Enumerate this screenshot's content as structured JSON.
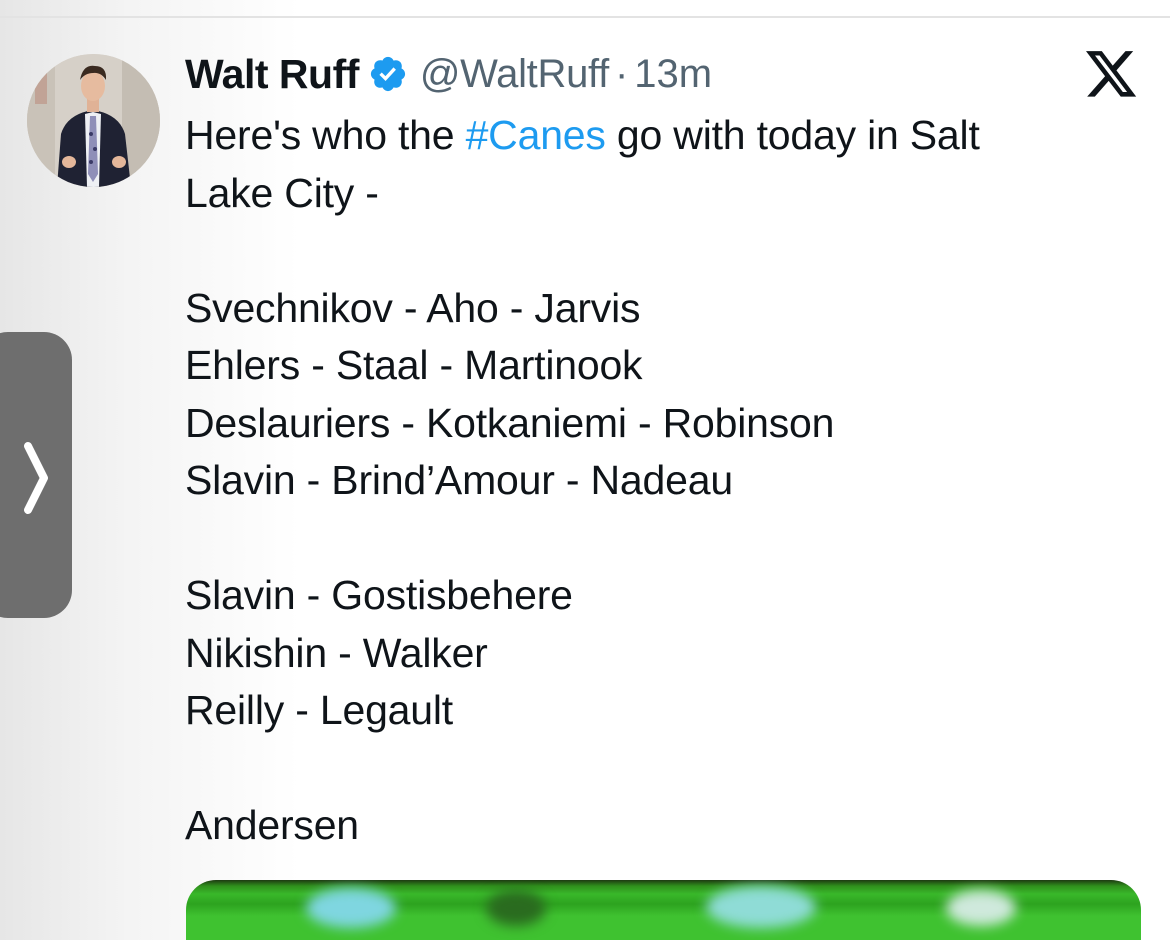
{
  "tweet": {
    "author_name": "Walt Ruff",
    "handle": "@WaltRuff",
    "separator": "·",
    "timestamp": "13m",
    "verified": true,
    "text_lines": [
      [
        "Here's who the ",
        "#Canes",
        " go with today in Salt"
      ],
      "Lake City -",
      "",
      "Svechnikov - Aho - Jarvis",
      "Ehlers - Staal - Martinook",
      "Deslauriers - Kotkaniemi - Robinson",
      "Slavin - Brind’Amour - Nadeau",
      "",
      "Slavin - Gostisbehere",
      "Nikishin - Walker",
      "Reilly - Legault",
      "",
      "Andersen"
    ]
  },
  "icons": {
    "verified": "verified-badge-icon",
    "brand": "x-logo-icon",
    "side_panel": "chevron-right-icon"
  },
  "colors": {
    "hashtag": "#1d9bf0",
    "verified": "#1d9bf0",
    "secondary_text": "#536471",
    "side_handle": "#6e6e6e"
  }
}
